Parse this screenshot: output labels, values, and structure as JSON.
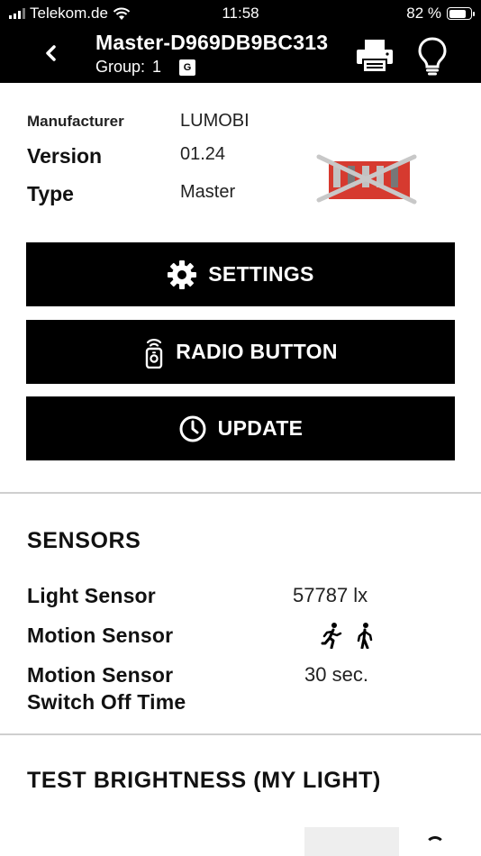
{
  "status_bar": {
    "carrier": "Telekom.de",
    "time": "11:58",
    "battery": "82 %",
    "battery_level": 0.82
  },
  "header": {
    "title": "Master-D969DB9BC313",
    "group_label": "Group:",
    "group_value": "1",
    "group_badge": "G"
  },
  "device_info": {
    "manufacturer_label": "Manufacturer",
    "manufacturer_value": "LUMOBI",
    "version_label": "Version",
    "version_value": "01.24",
    "type_label": "Type",
    "type_value": "Master"
  },
  "buttons": {
    "settings": "SETTINGS",
    "radio_button": "RADIO BUTTON",
    "update": "UPDATE"
  },
  "sensors": {
    "title": "SENSORS",
    "light_label": "Light Sensor",
    "light_value": "57787 lx",
    "motion_label": "Motion Sensor",
    "motion_icons": [
      "walking-person-icon",
      "standing-person-icon"
    ],
    "switch_off_label_line1": "Motion Sensor",
    "switch_off_label_line2": "Switch Off Time",
    "switch_off_value": "30 sec."
  },
  "brightness": {
    "title": "TEST BRIGHTNESS (MY LIGHT)"
  },
  "colors": {
    "header_bg": "#000000",
    "button_bg": "#000000",
    "divider": "#cfcfcf",
    "device_red": "#d63a2f"
  }
}
